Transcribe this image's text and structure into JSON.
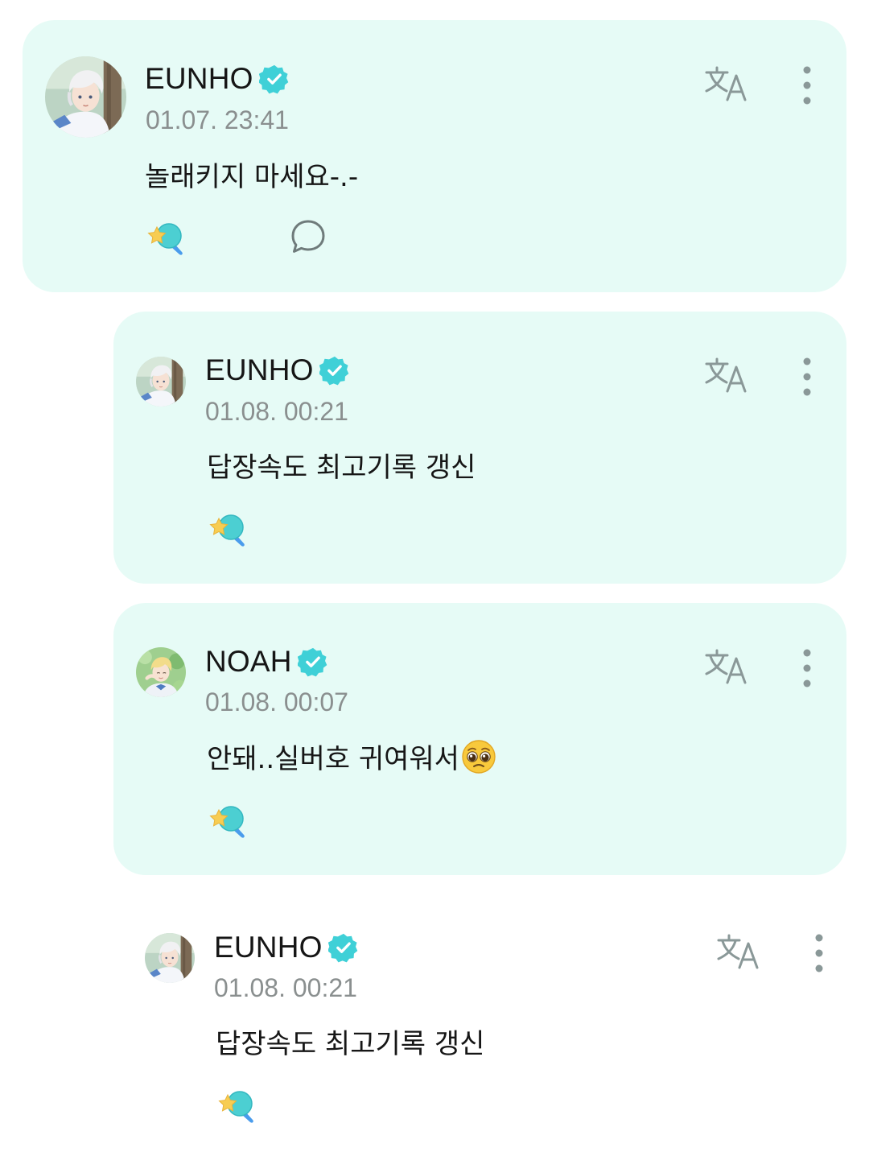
{
  "posts": [
    {
      "author": "EUNHO",
      "timestamp": "01.07. 23:41",
      "message": "놀래키지 마세요-.-",
      "avatar": "eunho-avatar",
      "verified": true,
      "has_comment_button": true
    },
    {
      "author": "EUNHO",
      "timestamp": "01.08. 00:21",
      "message": "답장속도 최고기록 갱신",
      "avatar": "eunho-avatar",
      "verified": true
    },
    {
      "author": "NOAH",
      "timestamp": "01.08. 00:07",
      "message": "안돼..실버호 귀여워서",
      "message_emoji": "pleading-face-emoji",
      "avatar": "noah-avatar",
      "verified": true
    },
    {
      "author": "EUNHO",
      "timestamp": "01.08. 00:21",
      "message": "답장속도 최고기록 갱신",
      "avatar": "eunho-avatar",
      "verified": true
    }
  ],
  "icons": {
    "translate": "translate-icon",
    "more": "more-vertical-icon",
    "reaction": "star-lightstick-reaction-icon",
    "comment": "comment-bubble-icon",
    "verified": "verified-badge-icon"
  },
  "colors": {
    "card_background": "#e6fbf6",
    "verified": "#3fd0d7",
    "icon_gray": "#8a9898",
    "timestamp": "#8a8f8f"
  }
}
